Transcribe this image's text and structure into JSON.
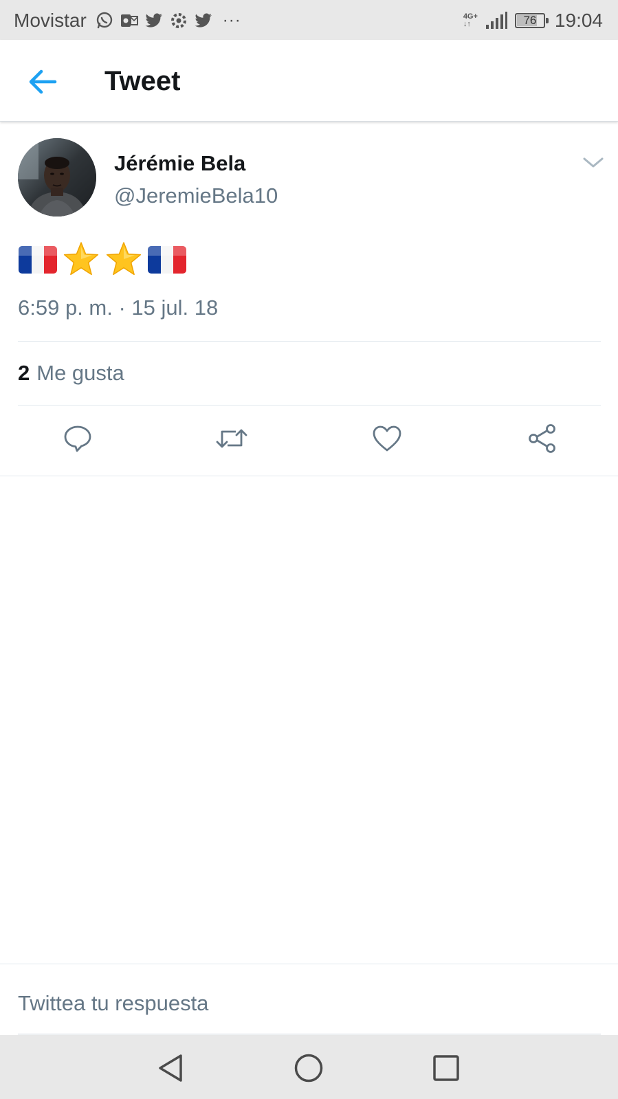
{
  "status_bar": {
    "carrier": "Movistar",
    "notification_icons": [
      "whatsapp-icon",
      "outlook-icon",
      "twitter-icon",
      "settings-icon",
      "twitter-icon"
    ],
    "more": "···",
    "network_type": "4G+",
    "network_sub": "↓↑",
    "battery_level": "76",
    "time": "19:04"
  },
  "header": {
    "title": "Tweet",
    "back_icon": "arrow-left-icon"
  },
  "tweet": {
    "author_name": "Jérémie Bela",
    "author_handle": "@JeremieBela10",
    "content_emojis": [
      "france-flag-emoji",
      "star-emoji",
      "star-emoji",
      "france-flag-emoji"
    ],
    "timestamp": "6:59 p. m. · 15 jul. 18",
    "likes_count": "2",
    "likes_label": "Me gusta"
  },
  "actions": [
    "reply-icon",
    "retweet-icon",
    "like-icon",
    "share-icon"
  ],
  "reply": {
    "placeholder": "Twittea tu respuesta"
  },
  "nav_bar": [
    "back-triangle-icon",
    "home-circle-icon",
    "recents-square-icon"
  ],
  "colors": {
    "accent": "#1da1f2",
    "text_primary": "#14171a",
    "text_secondary": "#657786",
    "divider": "#e1e8ed",
    "system_bar": "#e8e8e8"
  }
}
